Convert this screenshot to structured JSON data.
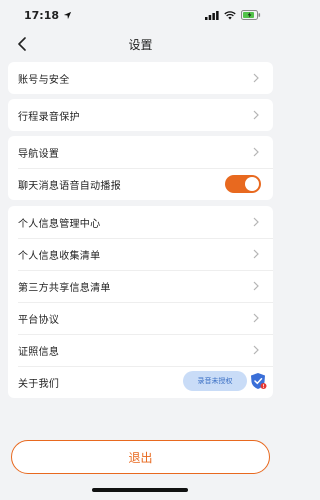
{
  "status": {
    "time": "17:18"
  },
  "nav": {
    "title": "设置"
  },
  "groups": [
    {
      "items": [
        {
          "label": "账号与安全"
        }
      ]
    },
    {
      "items": [
        {
          "label": "行程录音保护"
        }
      ]
    },
    {
      "items": [
        {
          "label": "导航设置"
        },
        {
          "label": "聊天消息语音自动播报",
          "toggle": true
        }
      ]
    },
    {
      "items": [
        {
          "label": "个人信息管理中心"
        },
        {
          "label": "个人信息收集清单"
        },
        {
          "label": "第三方共享信息清单"
        },
        {
          "label": "平台协议"
        },
        {
          "label": "证照信息"
        },
        {
          "label": "关于我们"
        }
      ]
    }
  ],
  "toggles": {
    "voice_broadcast": true
  },
  "floating": {
    "record_badge": "录音未授权",
    "icon": "shield-icon"
  },
  "logout": {
    "label": "退出"
  },
  "colors": {
    "accent": "#e8691f",
    "badge_bg": "#c9dcf7",
    "badge_text": "#3a6fc4"
  }
}
